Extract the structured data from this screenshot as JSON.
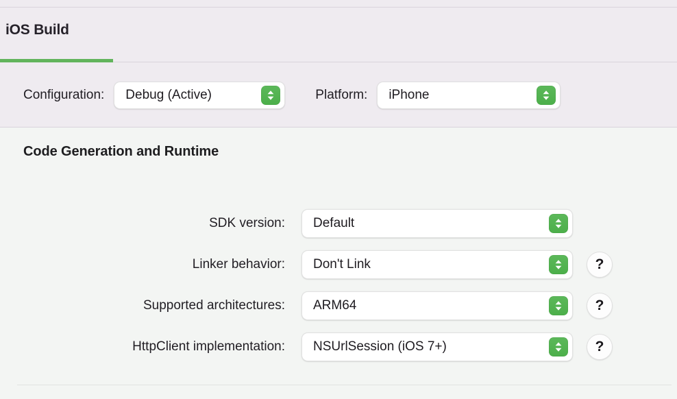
{
  "theme": {
    "header_bg": "#efebf0",
    "content_bg": "#f3f5f3",
    "accent_green": "#62b45c",
    "stepper_green": "#4caf4a",
    "text": "#201d23",
    "rule": "#d9d4dc"
  },
  "tab": {
    "label": "iOS Build",
    "selected": true
  },
  "toolbar": {
    "configuration": {
      "label": "Configuration:",
      "value": "Debug (Active)"
    },
    "platform": {
      "label": "Platform:",
      "value": "iPhone"
    }
  },
  "section": {
    "title": "Code Generation and Runtime",
    "rows": [
      {
        "label": "SDK version:",
        "value": "Default",
        "help": false,
        "help_label": ""
      },
      {
        "label": "Linker behavior:",
        "value": "Don't Link",
        "help": true,
        "help_label": "?"
      },
      {
        "label": "Supported architectures:",
        "value": "ARM64",
        "help": true,
        "help_label": "?"
      },
      {
        "label": "HttpClient implementation:",
        "value": "NSUrlSession (iOS 7+)",
        "help": true,
        "help_label": "?"
      }
    ]
  },
  "icons": {
    "stepper": "up-down-chevron-icon",
    "help": "question-mark-icon"
  }
}
